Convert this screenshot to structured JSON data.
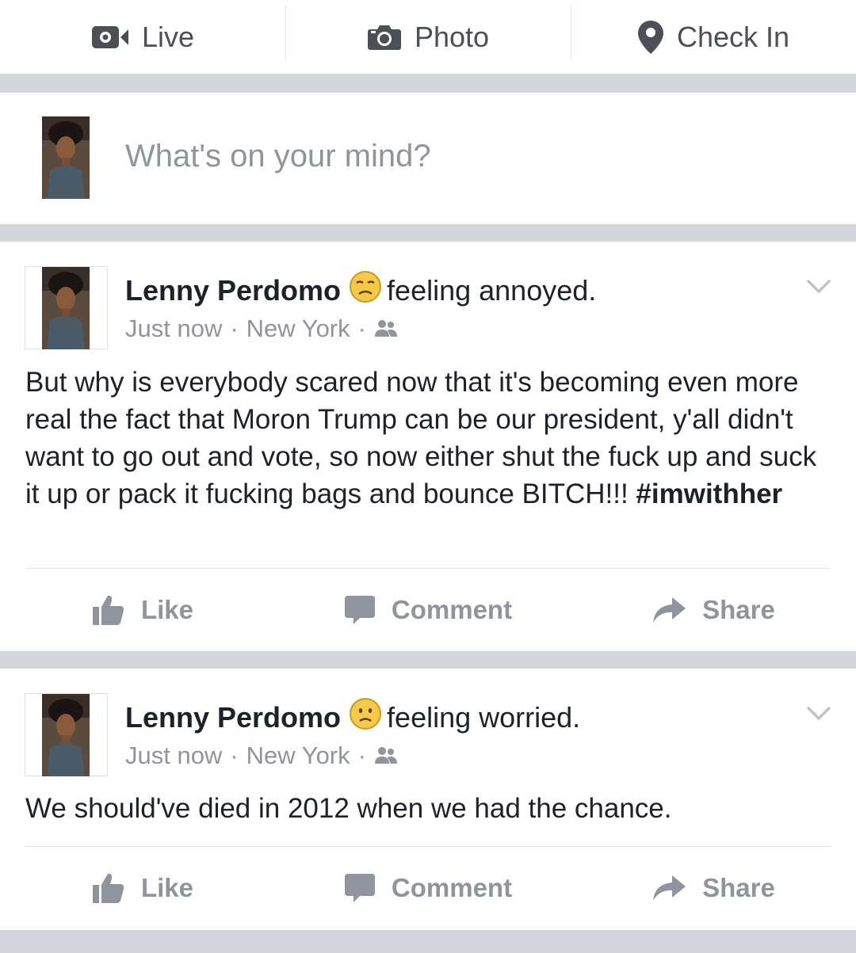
{
  "composer": {
    "live_label": "Live",
    "photo_label": "Photo",
    "checkin_label": "Check In",
    "placeholder": "What's on your mind?"
  },
  "posts": [
    {
      "author": "Lenny Perdomo",
      "feeling": "feeling annoyed.",
      "feeling_icon": "annoyed-emoji-icon",
      "time": "Just now",
      "location": "New York",
      "privacy_icon": "friends-icon",
      "text": "But why is everybody scared now that it's becoming even more real the fact that Moron Trump can be our president, y'all didn't want to go out and vote, so now either shut the fuck up and suck it up or pack it fucking bags and bounce BITCH!!! ",
      "hashtag": "#imwithher",
      "like_label": "Like",
      "comment_label": "Comment",
      "share_label": "Share"
    },
    {
      "author": "Lenny Perdomo",
      "feeling": "feeling worried.",
      "feeling_icon": "worried-emoji-icon",
      "time": "Just now",
      "location": "New York",
      "privacy_icon": "friends-icon",
      "text": "We should've died in 2012 when we had the chance.",
      "like_label": "Like",
      "comment_label": "Comment",
      "share_label": "Share"
    }
  ],
  "colors": {
    "separator": "#d3d6db",
    "secondary_text": "#90949c",
    "primary_text": "#1d2129"
  }
}
